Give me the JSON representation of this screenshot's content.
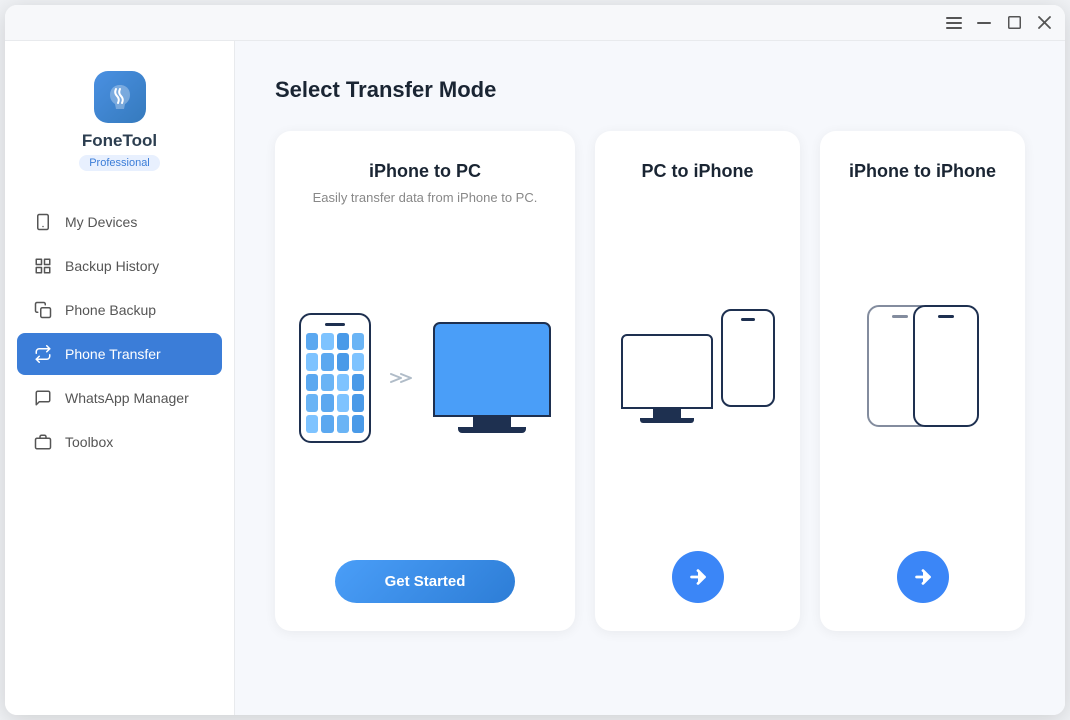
{
  "app": {
    "name": "FoneTool",
    "badge": "Professional"
  },
  "titlebar": {
    "menu_icon": "☰",
    "minimize_icon": "—",
    "maximize_icon": "□",
    "close_icon": "✕"
  },
  "sidebar": {
    "nav_items": [
      {
        "id": "my-devices",
        "label": "My Devices",
        "icon": "phone"
      },
      {
        "id": "backup-history",
        "label": "Backup History",
        "icon": "grid"
      },
      {
        "id": "phone-backup",
        "label": "Phone Backup",
        "icon": "copy"
      },
      {
        "id": "phone-transfer",
        "label": "Phone Transfer",
        "icon": "transfer",
        "active": true
      },
      {
        "id": "whatsapp-manager",
        "label": "WhatsApp Manager",
        "icon": "chat"
      },
      {
        "id": "toolbox",
        "label": "Toolbox",
        "icon": "toolbox"
      }
    ]
  },
  "main": {
    "title": "Select Transfer Mode",
    "cards": [
      {
        "id": "iphone-to-pc",
        "title": "iPhone to PC",
        "desc": "Easily transfer data from iPhone to PC.",
        "cta": "Get Started",
        "type": "large"
      },
      {
        "id": "pc-to-iphone",
        "title": "PC to iPhone",
        "desc": "",
        "cta": "→",
        "type": "medium"
      },
      {
        "id": "iphone-to-iphone",
        "title": "iPhone to iPhone",
        "desc": "",
        "cta": "→",
        "type": "medium"
      }
    ]
  }
}
